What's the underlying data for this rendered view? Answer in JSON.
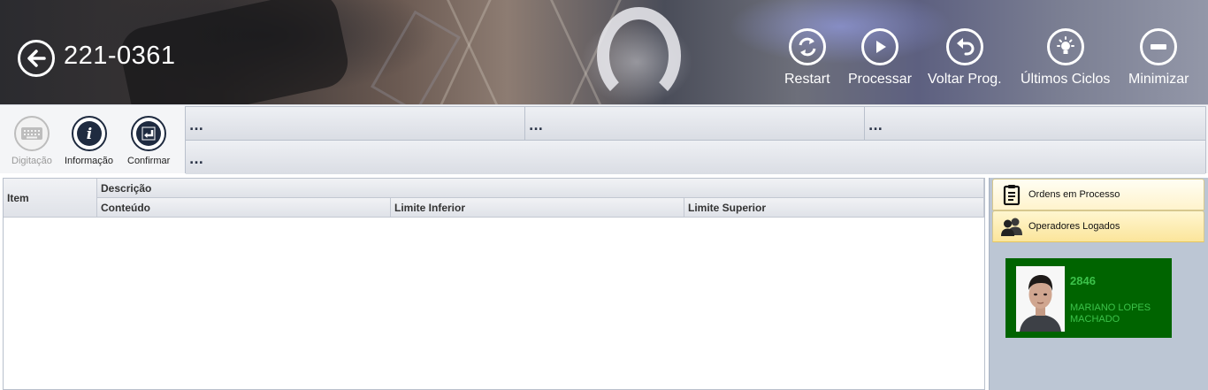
{
  "header": {
    "title": "221-0361",
    "actions": [
      {
        "label": "Restart",
        "icon": "refresh-icon"
      },
      {
        "label": "Processar",
        "icon": "play-icon"
      },
      {
        "label": "Voltar Prog.",
        "icon": "undo-arrow-icon"
      },
      {
        "label": "Últimos Ciclos",
        "icon": "lightbulb-icon"
      },
      {
        "label": "Minimizar",
        "icon": "minus-icon"
      }
    ]
  },
  "toolbar": {
    "tools": [
      {
        "label": "Digitação",
        "icon": "keyboard-icon",
        "enabled": false
      },
      {
        "label": "Informação",
        "icon": "info-icon",
        "enabled": true
      },
      {
        "label": "Confirmar",
        "icon": "enter-icon",
        "enabled": true
      }
    ],
    "info_cells": [
      "...",
      "...",
      "...",
      "..."
    ]
  },
  "table": {
    "col_item": "Item",
    "col_descricao": "Descrição",
    "col_conteudo": "Conteúdo",
    "col_limite_inferior": "Limite Inferior",
    "col_limite_superior": "Limite Superior",
    "rows": []
  },
  "right_panel": {
    "tabs": [
      {
        "label": "Ordens em Processo",
        "icon": "clipboard-icon"
      },
      {
        "label": "Operadores Logados",
        "icon": "users-icon"
      }
    ],
    "operator": {
      "id": "2846",
      "name": "MARIANO LOPES MACHADO"
    }
  },
  "colors": {
    "operator_card_bg": "#006400",
    "operator_text": "#3cc24a",
    "tab_active": "#fbe59b",
    "panel_bg": "#bcc6d4"
  }
}
